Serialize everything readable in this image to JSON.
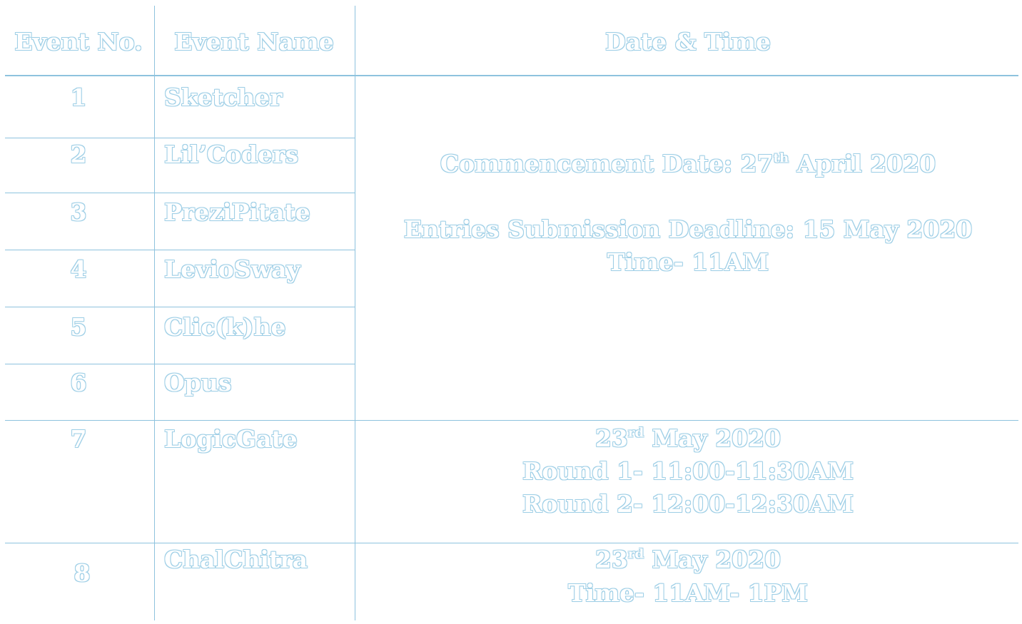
{
  "header": {
    "event_no": "Event No.",
    "event_name": "Event Name",
    "date_time": "Date & Time"
  },
  "rows": [
    {
      "no": "1",
      "name": "Sketcher"
    },
    {
      "no": "2",
      "name": "Lil’Coders"
    },
    {
      "no": "3",
      "name": "PreziPitate"
    },
    {
      "no": "4",
      "name": "LevioSway"
    },
    {
      "no": "5",
      "name": "Clic(k)he"
    },
    {
      "no": "6",
      "name": "Opus"
    },
    {
      "no": "7",
      "name": "LogicGate"
    },
    {
      "no": "8",
      "name": "ChalChitra"
    }
  ],
  "group1": {
    "commence_prefix": "Commencement Date: 27",
    "commence_sup": "th",
    "commence_suffix": " April 2020",
    "deadline": "Entries Submission Deadline: 15 May 2020",
    "time": "Time- 11AM"
  },
  "group2": {
    "date_prefix": "23",
    "date_sup": "rd",
    "date_suffix": " May 2020",
    "round1": "Round 1- 11:00-11:30AM",
    "round2": "Round 2- 12:00-12:30AM"
  },
  "group3": {
    "date_prefix": "23",
    "date_sup": "rd",
    "date_suffix": " May 2020",
    "time": "Time- 11AM- 1PM"
  },
  "colors": {
    "text_fill": "#ffffff",
    "text_outline": "#9fcfe6",
    "rule": "#8ec3de",
    "background": "#ffffff"
  }
}
